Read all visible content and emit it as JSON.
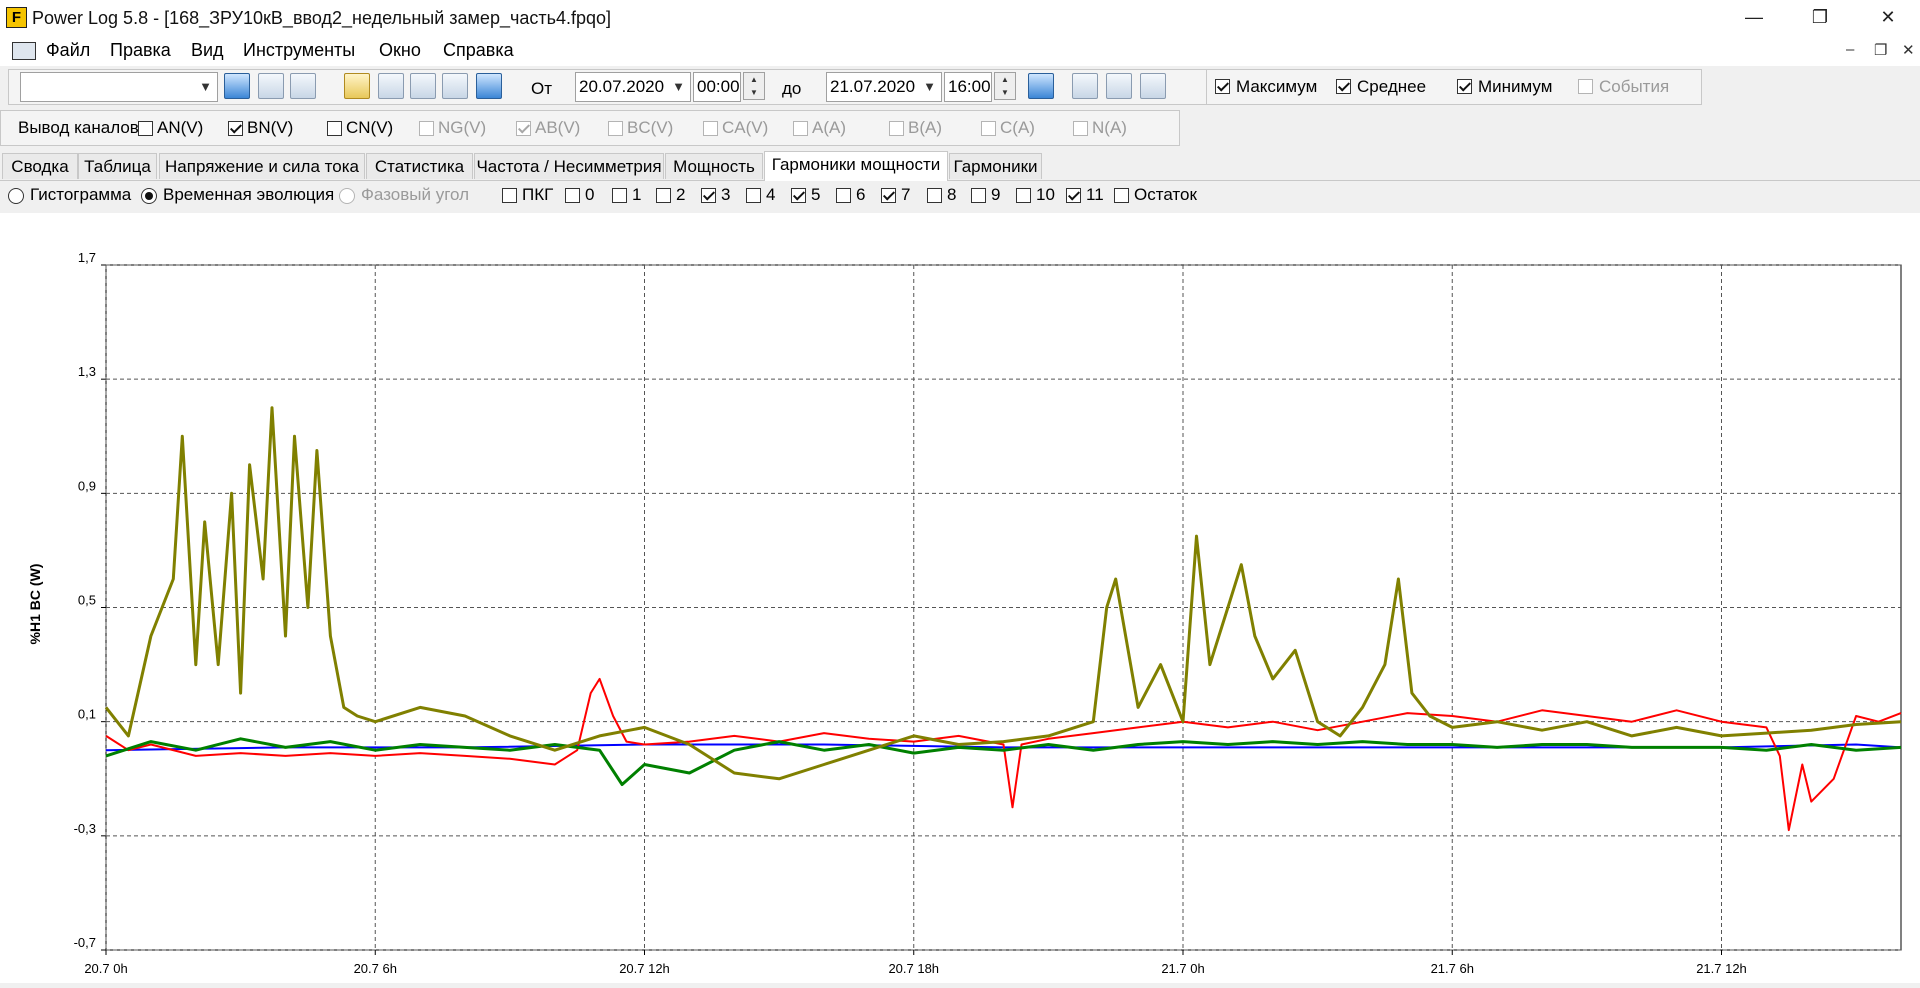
{
  "window": {
    "title": "Power Log 5.8 - [168_ЗРУ10кВ_ввод2_недельный замер_часть4.fpqo]",
    "logo_letter": "F",
    "minimize": "—",
    "restore": "❐",
    "close": "✕"
  },
  "menu": {
    "items": [
      "Файл",
      "Правка",
      "Вид",
      "Инструменты",
      "Окно",
      "Справка"
    ],
    "mdi_min": "–",
    "mdi_restore": "❐",
    "mdi_close": "✕"
  },
  "toolbar": {
    "preset_value": "",
    "from_label": "От",
    "from_date": "20.07.2020",
    "from_time": "00:00",
    "to_label": "до",
    "to_date": "21.07.2020",
    "to_time": "16:00",
    "max_label": "Максимум",
    "max_checked": true,
    "avg_label": "Среднее",
    "avg_checked": true,
    "min_label": "Минимум",
    "min_checked": true,
    "events_label": "События",
    "events_checked": false
  },
  "channels": {
    "label": "Вывод каналов",
    "items": [
      {
        "label": "AN(V)",
        "checked": false,
        "enabled": true
      },
      {
        "label": "BN(V)",
        "checked": true,
        "enabled": true
      },
      {
        "label": "CN(V)",
        "checked": false,
        "enabled": true
      },
      {
        "label": "NG(V)",
        "checked": false,
        "enabled": false
      },
      {
        "label": "AB(V)",
        "checked": true,
        "enabled": false
      },
      {
        "label": "BC(V)",
        "checked": false,
        "enabled": false
      },
      {
        "label": "CA(V)",
        "checked": false,
        "enabled": false
      },
      {
        "label": "A(A)",
        "checked": false,
        "enabled": false
      },
      {
        "label": "B(A)",
        "checked": false,
        "enabled": false
      },
      {
        "label": "C(A)",
        "checked": false,
        "enabled": false
      },
      {
        "label": "N(A)",
        "checked": false,
        "enabled": false
      }
    ]
  },
  "tabs": [
    {
      "label": "Сводка",
      "active": false
    },
    {
      "label": "Таблица",
      "active": false
    },
    {
      "label": "Напряжение и сила тока",
      "active": false
    },
    {
      "label": "Статистика",
      "active": false
    },
    {
      "label": "Частота / Несимметрия",
      "active": false
    },
    {
      "label": "Мощность",
      "active": false
    },
    {
      "label": "Гармоники мощности",
      "active": true
    },
    {
      "label": "Гармоники",
      "active": false
    }
  ],
  "view_options": [
    {
      "label": "Гистограмма",
      "selected": false,
      "enabled": true
    },
    {
      "label": "Временная эволюция",
      "selected": true,
      "enabled": true
    },
    {
      "label": "Фазовый угол",
      "selected": false,
      "enabled": false
    }
  ],
  "harmonics": [
    {
      "label": "ПКГ",
      "checked": false
    },
    {
      "label": "0",
      "checked": false
    },
    {
      "label": "1",
      "checked": false
    },
    {
      "label": "2",
      "checked": false
    },
    {
      "label": "3",
      "checked": true
    },
    {
      "label": "4",
      "checked": false
    },
    {
      "label": "5",
      "checked": true
    },
    {
      "label": "6",
      "checked": false
    },
    {
      "label": "7",
      "checked": true
    },
    {
      "label": "8",
      "checked": false
    },
    {
      "label": "9",
      "checked": false
    },
    {
      "label": "10",
      "checked": false
    },
    {
      "label": "11",
      "checked": true
    },
    {
      "label": "Остаток",
      "checked": false
    }
  ],
  "chart_data": {
    "type": "line",
    "ylabel": "%H1 BC (W)",
    "ylim": [
      -0.7,
      1.7
    ],
    "yticks": [
      "1,7",
      "1,3",
      "0,9",
      "0,5",
      "0,1",
      "-0,3",
      "-0,7"
    ],
    "ytick_values": [
      1.7,
      1.3,
      0.9,
      0.5,
      0.1,
      -0.3,
      -0.7
    ],
    "xlim_hours": [
      0,
      40
    ],
    "xticks": [
      "20.7 0h",
      "20.7 6h",
      "20.7 12h",
      "20.7 18h",
      "21.7 0h",
      "21.7 6h",
      "21.7 12h"
    ],
    "xtick_hours": [
      0,
      6,
      12,
      18,
      24,
      30,
      36
    ],
    "grid": true,
    "series": [
      {
        "color": "#0000ff",
        "width": 2,
        "x": [
          0,
          4,
          8,
          12,
          16,
          20,
          24,
          28,
          32,
          36,
          39,
          40
        ],
        "y": [
          0.0,
          0.01,
          0.01,
          0.02,
          0.02,
          0.01,
          0.01,
          0.01,
          0.01,
          0.01,
          0.02,
          0.01
        ]
      },
      {
        "color": "#ff0000",
        "width": 2,
        "x": [
          0,
          0.5,
          1,
          2,
          3,
          4,
          5,
          6,
          7,
          8,
          9,
          10,
          10.5,
          10.8,
          11,
          11.3,
          11.6,
          12,
          13,
          14,
          15,
          16,
          17,
          18,
          19,
          20,
          20.2,
          20.4,
          21,
          22,
          23,
          24,
          25,
          26,
          27,
          28,
          29,
          30,
          31,
          32,
          33,
          34,
          35,
          36,
          37,
          37.3,
          37.5,
          37.8,
          38,
          38.5,
          39,
          39.5,
          40
        ],
        "y": [
          0.05,
          0.0,
          0.02,
          -0.02,
          -0.01,
          -0.02,
          -0.01,
          -0.02,
          -0.01,
          -0.02,
          -0.03,
          -0.05,
          0.0,
          0.2,
          0.25,
          0.12,
          0.03,
          0.02,
          0.03,
          0.05,
          0.03,
          0.06,
          0.04,
          0.03,
          0.05,
          0.02,
          -0.2,
          0.02,
          0.04,
          0.06,
          0.08,
          0.1,
          0.08,
          0.1,
          0.07,
          0.1,
          0.13,
          0.12,
          0.1,
          0.14,
          0.12,
          0.1,
          0.14,
          0.1,
          0.08,
          -0.02,
          -0.28,
          -0.05,
          -0.18,
          -0.1,
          0.12,
          0.1,
          0.13
        ]
      },
      {
        "color": "#008000",
        "width": 3,
        "x": [
          0,
          1,
          2,
          3,
          4,
          5,
          6,
          7,
          8,
          9,
          10,
          11,
          11.5,
          12,
          13,
          14,
          15,
          16,
          17,
          18,
          19,
          20,
          21,
          22,
          23,
          24,
          25,
          26,
          27,
          28,
          29,
          30,
          31,
          32,
          33,
          34,
          35,
          36,
          37,
          38,
          39,
          40
        ],
        "y": [
          -0.02,
          0.03,
          0.0,
          0.04,
          0.01,
          0.03,
          0.0,
          0.02,
          0.01,
          0.0,
          0.02,
          0.0,
          -0.12,
          -0.05,
          -0.08,
          0.0,
          0.03,
          0.0,
          0.02,
          -0.01,
          0.01,
          0.0,
          0.02,
          0.0,
          0.02,
          0.03,
          0.02,
          0.03,
          0.02,
          0.03,
          0.02,
          0.02,
          0.01,
          0.02,
          0.02,
          0.01,
          0.01,
          0.01,
          0.0,
          0.02,
          0.0,
          0.01
        ]
      },
      {
        "color": "#808000",
        "width": 3,
        "x": [
          0,
          0.5,
          1,
          1.5,
          1.7,
          2,
          2.2,
          2.5,
          2.8,
          3,
          3.2,
          3.5,
          3.7,
          4,
          4.2,
          4.5,
          4.7,
          5,
          5.3,
          5.6,
          6,
          7,
          8,
          9,
          10,
          11,
          12,
          13,
          14,
          15,
          16,
          17,
          18,
          19,
          20,
          21,
          22,
          22.3,
          22.5,
          23,
          23.5,
          24,
          24.3,
          24.6,
          25,
          25.3,
          25.6,
          26,
          26.5,
          27,
          27.5,
          28,
          28.5,
          28.8,
          29.1,
          29.5,
          30,
          31,
          32,
          33,
          34,
          35,
          36,
          37,
          38,
          39,
          40
        ],
        "y": [
          0.15,
          0.05,
          0.4,
          0.6,
          1.1,
          0.3,
          0.8,
          0.3,
          0.9,
          0.2,
          1.0,
          0.6,
          1.2,
          0.4,
          1.1,
          0.5,
          1.05,
          0.4,
          0.15,
          0.12,
          0.1,
          0.15,
          0.12,
          0.05,
          0.0,
          0.05,
          0.08,
          0.02,
          -0.08,
          -0.1,
          -0.05,
          0.0,
          0.05,
          0.02,
          0.03,
          0.05,
          0.1,
          0.5,
          0.6,
          0.15,
          0.3,
          0.1,
          0.75,
          0.3,
          0.5,
          0.65,
          0.4,
          0.25,
          0.35,
          0.1,
          0.05,
          0.15,
          0.3,
          0.6,
          0.2,
          0.12,
          0.08,
          0.1,
          0.07,
          0.1,
          0.05,
          0.08,
          0.05,
          0.06,
          0.07,
          0.09,
          0.1
        ]
      }
    ]
  }
}
